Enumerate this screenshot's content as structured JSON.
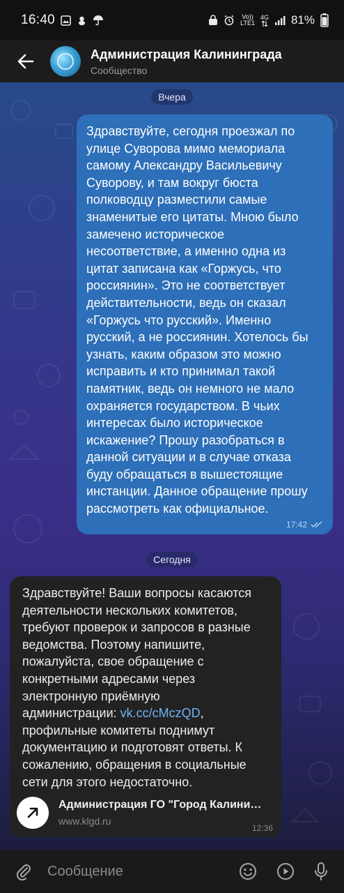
{
  "status_bar": {
    "time": "16:40",
    "volte_line1": "Vo))",
    "volte_line2": "LTE1",
    "network": "4G",
    "battery": "81%"
  },
  "header": {
    "title": "Администрация Калининграда",
    "subtitle": "Сообщество"
  },
  "chat": {
    "date_yesterday": "Вчера",
    "date_today": "Сегодня",
    "outgoing": {
      "text": "Здравствуйте, сегодня проезжал по\nулице Суворова мимо мемориала\nсамому Александру Васильевичу\nСуворову, и там вокруг бюста\nполководцу разместили самые\nзнаменитые его цитаты. Мною было\nзамечено историческое\nнесоответствие, а именно одна из\nцитат записана как «Горжусь, что\nроссиянин». Это не соответствует\nдействительности, ведь он сказал\n«Горжусь что русский». Именно\nрусский, а не россиянин. Хотелось бы\nузнать, каким образом это можно\nисправить и кто принимал такой\nпамятник, ведь он немного не мало\nохраняется государством. В чьих\nинтересах было историческое\nискажение? Прошу разобраться в\nданной ситуации и в случае отказа\nбуду обращаться в вышестоящие\nинстанции. Данное обращение прошу\nрассмотреть как официальное.",
      "time": "17:42"
    },
    "incoming": {
      "text_before_link": "Здравствуйте! Ваши вопросы касаются\nдеятельности нескольких комитетов,\nтребуют проверок и запросов в разные\nведомства. Поэтому напишите,\nпожалуйста, свое обращение с\nконкретными адресами через\nэлектронную приёмную\nадминистрации: ",
      "link": "vk.cc/cMczQD",
      "text_after_link": ",\nпрофильные комитеты поднимут\nдокументацию и подготовят ответы. К\nсожалению, обращения в социальные\nсети для этого недостаточно.",
      "preview_title": "Администрация ГО \"Город Калининград\"",
      "preview_domain": "www.klgd.ru",
      "time": "12:36"
    }
  },
  "input": {
    "placeholder": "Сообщение"
  },
  "colors": {
    "outgoing_bubble": "#2d6fb8",
    "incoming_bubble": "#222222",
    "link": "#6fb3f5"
  },
  "icons": {
    "back": "arrow-left-icon",
    "attach": "paperclip-icon",
    "emoji": "smile-icon",
    "send_video": "play-circle-icon",
    "voice": "microphone-icon",
    "read": "double-check-icon",
    "link_preview": "arrow-up-right-icon"
  }
}
